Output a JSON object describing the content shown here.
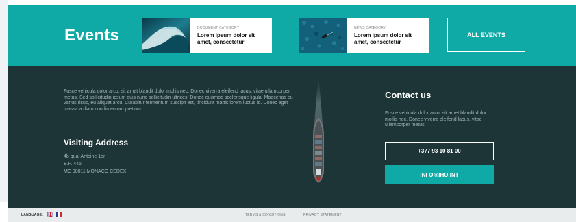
{
  "events": {
    "title": "Events",
    "cards": [
      {
        "category": "DOCUMENT CATEGORY",
        "headline": "Lorem ipsum dolor sit amet, consectetur",
        "image": "ocean-wave"
      },
      {
        "category": "NEWS CATEGORY",
        "headline": "Lorem ipsum dolor sit amet, consectetur",
        "image": "aerial-boat"
      }
    ],
    "all_events_label": "ALL EVENTS"
  },
  "about": {
    "intro": "Fusce vehicula dolor arcu, sit amet blandit dolor mollis nec. Donec viverra eleifend lacus, vitae ullamcorper metus. Sed sollicitudin ipsum quis nunc sollicitudin ultrices. Donec euismod scelerisque ligula. Maecenas eu varius risus, eu aliquet arcu. Curabitur fermentum suscipit est, tincidunt mattis lorem luctus id. Donec eget massa a diam condimentum pretium.",
    "visiting_title": "Visiting Address",
    "address_lines": [
      "4b quai Antoine 1er",
      "B.P. 445",
      "MC 98011 MONACO CEDEX"
    ]
  },
  "contact": {
    "title": "Contact us",
    "text": "Fusce vehicula dolor arcu, sit amet blandit dolor mollis nec. Donec viverra eleifend lacus, vitae ullamcorper metus.",
    "phone": "+377 93 10 81 00",
    "email": "INFO@IHO.INT"
  },
  "footer": {
    "language_label": "LANGUAGE:",
    "flags": [
      "uk-flag",
      "france-flag"
    ],
    "links": [
      "TERMS & CONDITIONS",
      "PRIVACY STATEMENT"
    ]
  },
  "colors": {
    "teal": "#0fa9a6",
    "dark": "#1e3538",
    "footer": "#e8ecec"
  }
}
